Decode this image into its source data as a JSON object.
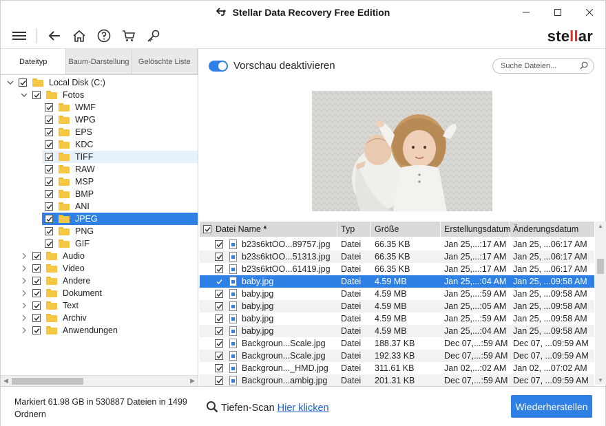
{
  "window": {
    "title": "Stellar Data Recovery Free Edition",
    "controls": [
      "minimize",
      "maximize",
      "close"
    ]
  },
  "toolbar": {
    "icons": [
      "menu-icon",
      "back-arrow-icon",
      "home-icon",
      "help-icon",
      "cart-icon",
      "key-icon"
    ],
    "logo": {
      "prefix": "ste",
      "accent": "ll",
      "suffix": "ar"
    }
  },
  "left_panel": {
    "tabs": [
      "Dateityp",
      "Baum-Darstellung",
      "Gelöschte Liste"
    ],
    "active_tab": 0,
    "tree": [
      {
        "label": "Local Disk (C:)",
        "checked": true,
        "expanded": true
      },
      {
        "label": "Fotos",
        "checked": true,
        "expanded": true
      },
      {
        "label": "WMF",
        "checked": true
      },
      {
        "label": "WPG",
        "checked": true
      },
      {
        "label": "EPS",
        "checked": true
      },
      {
        "label": "KDC",
        "checked": true
      },
      {
        "label": "TIFF",
        "checked": true,
        "hover": true
      },
      {
        "label": "RAW",
        "checked": true
      },
      {
        "label": "MSP",
        "checked": true
      },
      {
        "label": "BMP",
        "checked": true
      },
      {
        "label": "ANI",
        "checked": true
      },
      {
        "label": "JPEG",
        "checked": true,
        "selected": true
      },
      {
        "label": "PNG",
        "checked": true
      },
      {
        "label": "GIF",
        "checked": true
      },
      {
        "label": "Audio",
        "checked": true,
        "expanded": false
      },
      {
        "label": "Video",
        "checked": true,
        "expanded": false
      },
      {
        "label": "Andere",
        "checked": true,
        "expanded": false
      },
      {
        "label": "Dokument",
        "checked": true,
        "expanded": false
      },
      {
        "label": "Text",
        "checked": true,
        "expanded": false
      },
      {
        "label": "Archiv",
        "checked": true,
        "expanded": false
      },
      {
        "label": "Anwendungen",
        "checked": true,
        "expanded": false
      }
    ]
  },
  "preview": {
    "toggle_label": "Vorschau deaktivieren",
    "toggle_on": true,
    "search_placeholder": "Suche Dateien..."
  },
  "file_list": {
    "columns": [
      "Datei Name",
      "Typ",
      "Größe",
      "Erstellungsdatum",
      "Änderungsdatum"
    ],
    "sorted_column": "Datei Name",
    "rows": [
      {
        "name": "b23s6ktOO...89757.jpg",
        "type": "Datei",
        "size": "66.35 KB",
        "created": "Jan 25,...:17 AM",
        "modified": "Jan 25, ...06:17 AM"
      },
      {
        "name": "b23s6ktOO...51313.jpg",
        "type": "Datei",
        "size": "66.35 KB",
        "created": "Jan 25,...:17 AM",
        "modified": "Jan 25, ...06:17 AM"
      },
      {
        "name": "b23s6ktOO...61419.jpg",
        "type": "Datei",
        "size": "66.35 KB",
        "created": "Jan 25,...:17 AM",
        "modified": "Jan 25, ...06:17 AM"
      },
      {
        "name": "baby.jpg",
        "type": "Datei",
        "size": "4.59 MB",
        "created": "Jan 25,...:04 AM",
        "modified": "Jan 25, ...09:58 AM",
        "selected": true
      },
      {
        "name": "baby.jpg",
        "type": "Datei",
        "size": "4.59 MB",
        "created": "Jan 25,...:59 AM",
        "modified": "Jan 25, ...09:58 AM"
      },
      {
        "name": "baby.jpg",
        "type": "Datei",
        "size": "4.59 MB",
        "created": "Jan 25,...:05 AM",
        "modified": "Jan 25, ...09:58 AM"
      },
      {
        "name": "baby.jpg",
        "type": "Datei",
        "size": "4.59 MB",
        "created": "Jan 25,...:59 AM",
        "modified": "Jan 25, ...09:58 AM"
      },
      {
        "name": "baby.jpg",
        "type": "Datei",
        "size": "4.59 MB",
        "created": "Jan 25,...:04 AM",
        "modified": "Jan 25, ...09:58 AM"
      },
      {
        "name": "Backgroun...Scale.jpg",
        "type": "Datei",
        "size": "188.37 KB",
        "created": "Dec 07,...:59 AM",
        "modified": "Dec 07, ...09:59 AM"
      },
      {
        "name": "Backgroun...Scale.jpg",
        "type": "Datei",
        "size": "192.33 KB",
        "created": "Dec 07,...:59 AM",
        "modified": "Dec 07, ...09:59 AM"
      },
      {
        "name": "Backgroun..._HMD.jpg",
        "type": "Datei",
        "size": "311.61 KB",
        "created": "Jan 02,...:02 AM",
        "modified": "Jan 02, ...07:02 AM"
      },
      {
        "name": "Backgroun...ambig.jpg",
        "type": "Datei",
        "size": "201.31 KB",
        "created": "Dec 07,...:59 AM",
        "modified": "Dec 07, ...09:59 AM"
      }
    ]
  },
  "footer": {
    "status": "Markiert 61.98 GB in 530887 Dateien in 1499 Ordnern",
    "deep_scan_label": "Tiefen-Scan",
    "deep_scan_link": "Hier klicken",
    "recover_button": "Wiederherstellen"
  },
  "colors": {
    "accent": "#2f80e4",
    "logo_accent": "#e22b2b",
    "folder": "#f6c744",
    "link": "#1a5fc9"
  }
}
